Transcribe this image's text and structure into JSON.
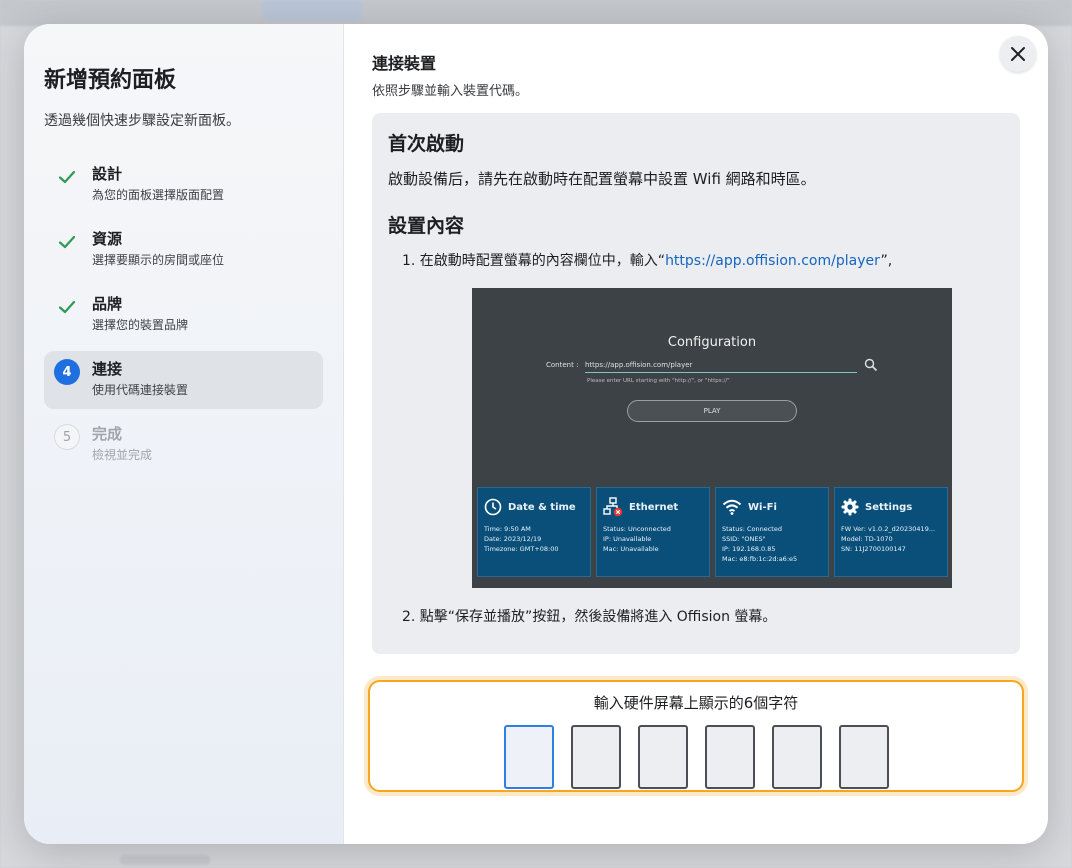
{
  "sidebar": {
    "title": "新增預約面板",
    "description": "透過幾個快速步驟設定新面板。",
    "steps": [
      {
        "number": "1",
        "title": "設計",
        "subtitle": "為您的面板選擇版面配置",
        "status": "done"
      },
      {
        "number": "2",
        "title": "資源",
        "subtitle": "選擇要顯示的房間或座位",
        "status": "done"
      },
      {
        "number": "3",
        "title": "品牌",
        "subtitle": "選擇您的裝置品牌",
        "status": "done"
      },
      {
        "number": "4",
        "title": "連接",
        "subtitle": "使用代碼連接裝置",
        "status": "active"
      },
      {
        "number": "5",
        "title": "完成",
        "subtitle": "檢視並完成",
        "status": "pending"
      }
    ]
  },
  "main": {
    "title": "連接裝置",
    "subtitle": "依照步驟並輸入裝置代碼。",
    "guide": {
      "heading1": "首次啟動",
      "paragraph1": "啟動設備后，請先在啟動時在配置螢幕中設置 Wifi 網路和時區。",
      "heading2": "設置內容",
      "step1_prefix": "1. 在啟動時配置螢幕的內容欄位中，輸入“",
      "step1_link": "https://app.offision.com/player",
      "step1_suffix": "”,",
      "step2": "2. 點擊“保存並播放”按鈕，然後設備將進入 Offision 螢幕。",
      "screenshot": {
        "title": "Configuration",
        "content_label": "Content :",
        "content_value": "https://app.offision.com/player",
        "helper": "Please enter URL starting with \"http://\", or \"https://\"",
        "play_label": "PLAY",
        "tiles": [
          {
            "title": "Date & time",
            "lines": [
              "Time: 9:50 AM",
              "Date: 2023/12/19",
              "Timezone: GMT+08:00"
            ]
          },
          {
            "title": "Ethernet",
            "lines": [
              "Status: Unconnected",
              "IP: Unavailable",
              "Mac: Unavailable"
            ]
          },
          {
            "title": "Wi-Fi",
            "lines": [
              "Status: Connected",
              "SSID: \"ONES\"",
              "IP: 192.168.0.85",
              "Mac: e8:fb:1c:2d:a6:e5"
            ]
          },
          {
            "title": "Settings",
            "lines": [
              "FW Ver: v1.0.2_d20230419...",
              "Model: TD-1070",
              "SN: 11J2700100147"
            ]
          }
        ]
      }
    },
    "code_prompt": "輸入硬件屏幕上顯示的6個字符",
    "code_values": [
      "",
      "",
      "",
      "",
      "",
      ""
    ]
  },
  "colors": {
    "accent": "#1f6fe0",
    "check": "#2e9a55",
    "highlight_border": "#f5a623",
    "link": "#1565c0",
    "tile": "#0a4f7a"
  },
  "icons": {
    "close": "close-icon",
    "check": "check-icon",
    "search": "search-icon",
    "clock": "clock-icon",
    "ethernet": "ethernet-icon",
    "wifi": "wifi-icon",
    "settings": "gear-icon"
  }
}
